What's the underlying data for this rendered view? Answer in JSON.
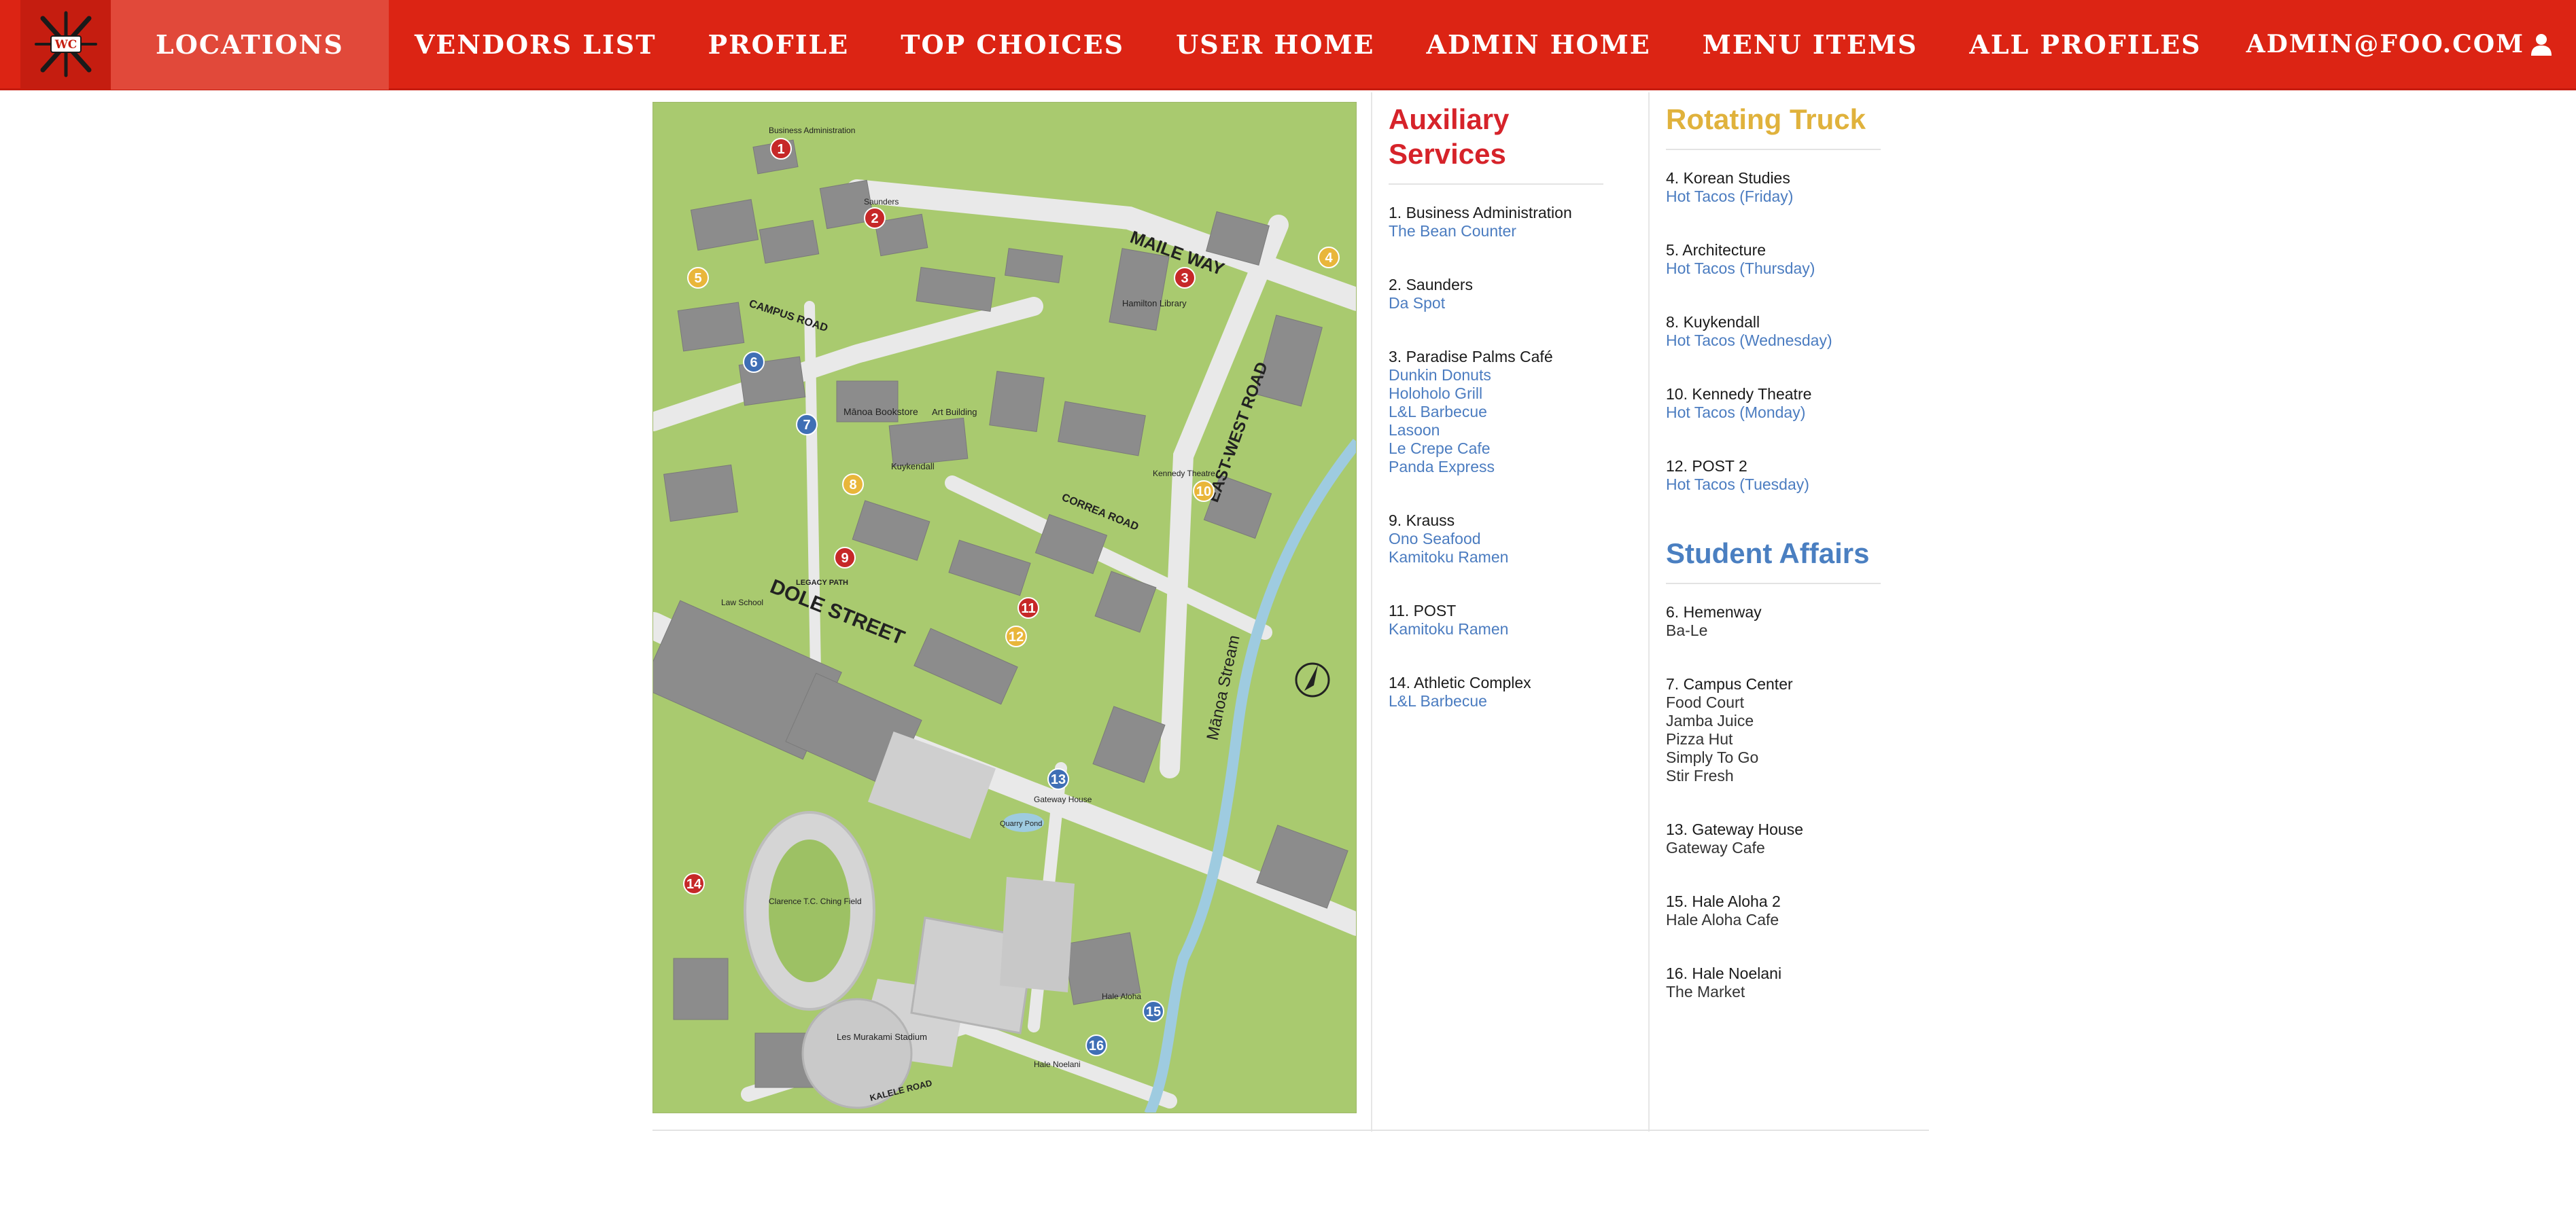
{
  "nav": {
    "items": [
      {
        "label": "LOCATIONS",
        "active": true
      },
      {
        "label": "VENDORS LIST"
      },
      {
        "label": "PROFILE"
      },
      {
        "label": "TOP CHOICES"
      },
      {
        "label": "USER HOME"
      },
      {
        "label": "ADMIN HOME"
      },
      {
        "label": "MENU ITEMS"
      },
      {
        "label": "ALL PROFILES"
      }
    ],
    "user": "ADMIN@FOO.COM",
    "logo_text": "WC",
    "user_icon": "user-icon"
  },
  "colors": {
    "nav_bg": "#dc2414",
    "auxiliary": "#d6232a",
    "truck": "#e0b23c",
    "student": "#4a7fc1",
    "link": "#4b7cc0"
  },
  "map": {
    "labels": {
      "maile_way": "MAILE WAY",
      "east_west_road": "EAST-WEST ROAD",
      "dole_street": "DOLE STREET",
      "campus_road": "CAMPUS ROAD",
      "correa_road": "CORREA ROAD",
      "manoa_stream": "Mānoa Stream",
      "manoa_bookstore": "Mānoa Bookstore",
      "business_admin": "Business Administration",
      "saunders": "Saunders",
      "art_building": "Art Building",
      "kuykendall": "Kuykendall",
      "hamilton_library": "Hamilton Library",
      "kennedy_theatre": "Kennedy Theatre",
      "law_school": "Law School",
      "les_murakami": "Les Murakami Stadium",
      "clarence_tc_ching": "Clarence T.C. Ching Field",
      "gateway_house": "Gateway House",
      "hale_aloha": "Hale Aloha",
      "hale_noelani": "Hale Noelani",
      "quarry_pond": "Quarry Pond",
      "legacy_path": "LEGACY PATH",
      "kalele_road": "KALELE ROAD"
    },
    "markers": [
      {
        "n": "1",
        "color": "red"
      },
      {
        "n": "2",
        "color": "red"
      },
      {
        "n": "3",
        "color": "red"
      },
      {
        "n": "4",
        "color": "yellow"
      },
      {
        "n": "5",
        "color": "yellow"
      },
      {
        "n": "6",
        "color": "blue"
      },
      {
        "n": "7",
        "color": "blue"
      },
      {
        "n": "8",
        "color": "yellow"
      },
      {
        "n": "9",
        "color": "red"
      },
      {
        "n": "10",
        "color": "yellow"
      },
      {
        "n": "11",
        "color": "red"
      },
      {
        "n": "12",
        "color": "yellow"
      },
      {
        "n": "13",
        "color": "blue"
      },
      {
        "n": "14",
        "color": "red"
      },
      {
        "n": "15",
        "color": "blue"
      },
      {
        "n": "16",
        "color": "blue"
      }
    ]
  },
  "auxiliary": {
    "title": "Auxiliary Services",
    "locations": [
      {
        "name": "1. Business Administration",
        "vendors": [
          "The Bean Counter"
        ]
      },
      {
        "name": "2. Saunders",
        "vendors": [
          "Da Spot"
        ]
      },
      {
        "name": "3. Paradise Palms Café",
        "vendors": [
          "Dunkin Donuts",
          "Holoholo Grill",
          "L&L Barbecue",
          "Lasoon",
          "Le Crepe Cafe",
          "Panda Express"
        ]
      },
      {
        "name": "9. Krauss",
        "vendors": [
          "Ono Seafood",
          "Kamitoku Ramen"
        ]
      },
      {
        "name": "11. POST",
        "vendors": [
          "Kamitoku Ramen"
        ]
      },
      {
        "name": "14. Athletic Complex",
        "vendors": [
          "L&L Barbecue"
        ]
      }
    ]
  },
  "truck": {
    "title": "Rotating Truck",
    "locations": [
      {
        "name": "4. Korean Studies",
        "vendors": [
          "Hot Tacos (Friday)"
        ]
      },
      {
        "name": "5. Architecture",
        "vendors": [
          "Hot Tacos (Thursday)"
        ]
      },
      {
        "name": "8. Kuykendall",
        "vendors": [
          "Hot Tacos (Wednesday)"
        ]
      },
      {
        "name": "10. Kennedy Theatre",
        "vendors": [
          "Hot Tacos (Monday)"
        ]
      },
      {
        "name": "12. POST 2",
        "vendors": [
          "Hot Tacos (Tuesday)"
        ]
      }
    ]
  },
  "student": {
    "title": "Student Affairs",
    "locations": [
      {
        "name": "6. Hemenway",
        "vendors": [
          "Ba-Le"
        ]
      },
      {
        "name": "7. Campus Center",
        "vendors": [
          "Food Court",
          "Jamba Juice",
          "Pizza Hut",
          "Simply To Go",
          "Stir Fresh"
        ]
      },
      {
        "name": "13. Gateway House",
        "vendors": [
          "Gateway Cafe"
        ]
      },
      {
        "name": "15. Hale Aloha 2",
        "vendors": [
          "Hale Aloha Cafe"
        ]
      },
      {
        "name": "16. Hale Noelani",
        "vendors": [
          "The Market"
        ]
      }
    ]
  }
}
